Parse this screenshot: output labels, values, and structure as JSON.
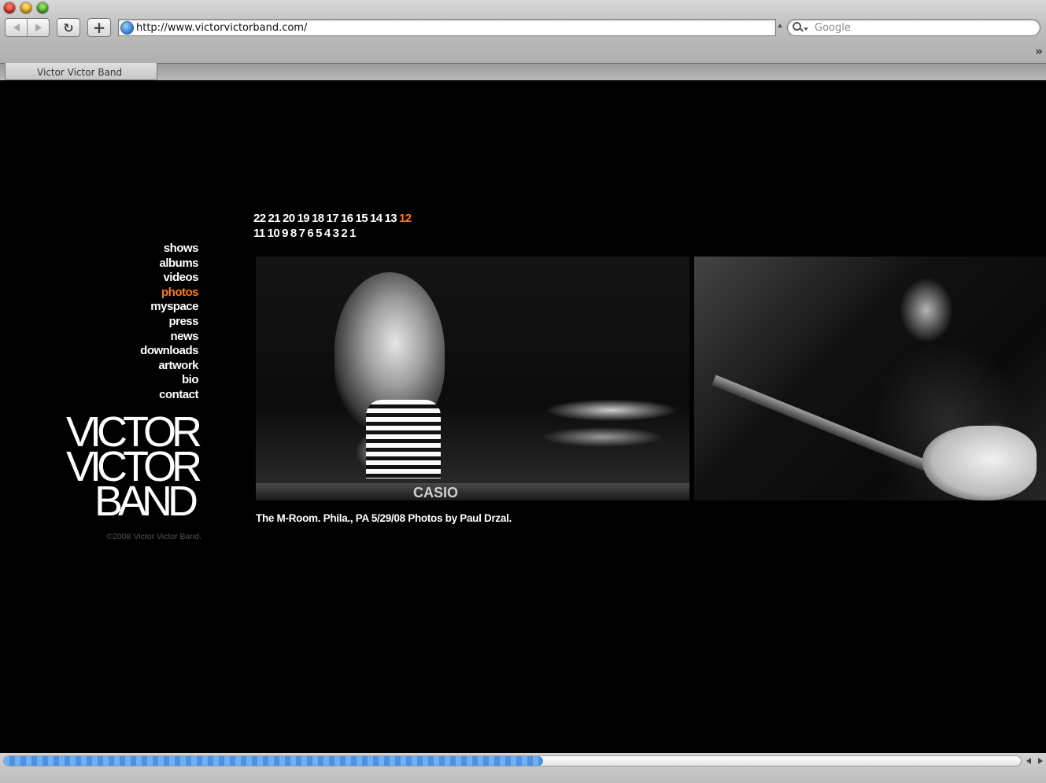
{
  "browser": {
    "url": "http://www.victorvictorband.com/",
    "search_placeholder": "Google",
    "tab_title": "Victor Victor Band",
    "load_progress": 0.53
  },
  "nav": {
    "items": [
      {
        "label": "shows",
        "active": false
      },
      {
        "label": "albums",
        "active": false
      },
      {
        "label": "videos",
        "active": false
      },
      {
        "label": "photos",
        "active": true
      },
      {
        "label": "myspace",
        "active": false
      },
      {
        "label": "press",
        "active": false
      },
      {
        "label": "news",
        "active": false
      },
      {
        "label": "downloads",
        "active": false
      },
      {
        "label": "artwork",
        "active": false
      },
      {
        "label": "bio",
        "active": false
      },
      {
        "label": "contact",
        "active": false
      }
    ]
  },
  "logo": {
    "line1": "VICTOR",
    "line2": "VICTOR",
    "line3": "BAND"
  },
  "copyright": "©2008 Victor Victor Band.",
  "gallery": {
    "row1": [
      "22",
      "21",
      "20",
      "19",
      "18",
      "17",
      "16",
      "15",
      "14",
      "13",
      "12"
    ],
    "row2": [
      "11",
      "10",
      "9",
      "8",
      "7",
      "6",
      "5",
      "4",
      "3",
      "2",
      "1"
    ],
    "current": "12",
    "photo_text": "CASIO",
    "caption": "The M-Room. Phila., PA 5/29/08 Photos by Paul Drzal."
  },
  "colors": {
    "accent": "#ff7a18",
    "background": "#000000",
    "text": "#ffffff"
  },
  "icons": {
    "back": "back-arrow-icon",
    "forward": "forward-arrow-icon",
    "reload": "reload-icon",
    "add": "plus-icon",
    "site": "globe-icon",
    "search": "magnifier-icon",
    "overflow": "double-chevron-icon"
  }
}
